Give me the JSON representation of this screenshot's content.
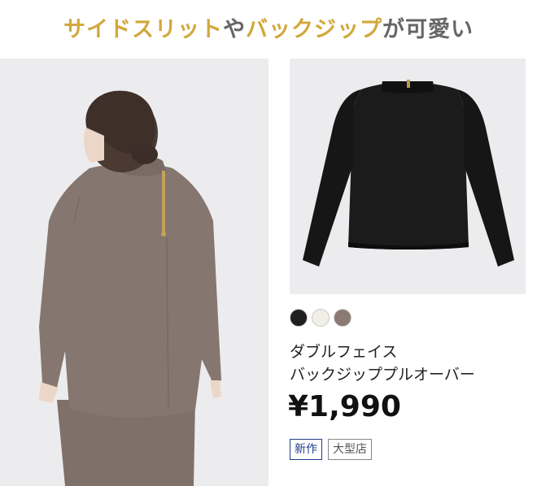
{
  "headline": {
    "part1": "サイドスリット",
    "part2": "や",
    "part3": "バックジップ",
    "part4": "が可愛い"
  },
  "images": {
    "model": "model-back-view-photo",
    "product": "black-sweater-product-photo"
  },
  "colors": {
    "accent_gold": "#d2a83c",
    "swatches": [
      "#1f1f1f",
      "#f2efe8",
      "#8a7a72"
    ]
  },
  "swatch_names": [
    "black",
    "off-white",
    "brown"
  ],
  "product": {
    "name_line1": "ダブルフェイス",
    "name_line2": "バックジッププルオーバー",
    "price": "¥1,990"
  },
  "tags": {
    "new": "新作",
    "store": "大型店"
  }
}
